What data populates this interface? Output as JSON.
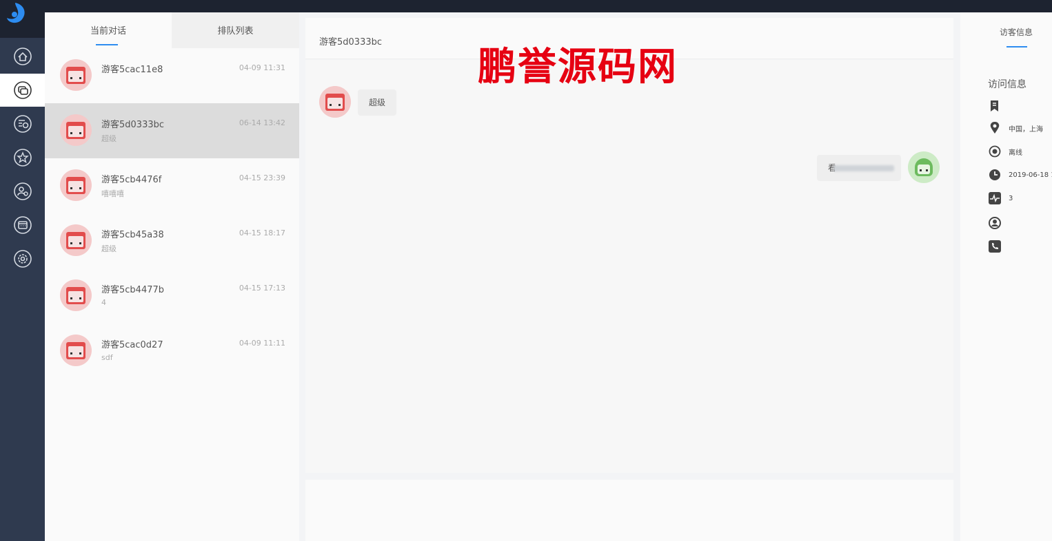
{
  "list": {
    "tabs": [
      "当前对话",
      "排队列表"
    ],
    "conversations": [
      {
        "name": "游客5cac11e8",
        "time": "04-09 11:31",
        "preview": ""
      },
      {
        "name": "游客5d0333bc",
        "time": "06-14 13:42",
        "preview": "超级"
      },
      {
        "name": "游客5cb4476f",
        "time": "04-15 23:39",
        "preview": "嘻嘻嘻"
      },
      {
        "name": "游客5cb45a38",
        "time": "04-15 18:17",
        "preview": "超级"
      },
      {
        "name": "游客5cb4477b",
        "time": "04-15 17:13",
        "preview": "4"
      },
      {
        "name": "游客5cac0d27",
        "time": "04-09 11:11",
        "preview": "sdf"
      }
    ]
  },
  "chat": {
    "title": "游客5d0333bc",
    "messages": [
      {
        "from": "visitor",
        "text": "超级"
      },
      {
        "from": "agent",
        "text": "看"
      }
    ]
  },
  "watermark": "鹏誉源码网",
  "info": {
    "tab": "访客信息",
    "heading": "访问信息",
    "rows": [
      {
        "icon": "bookmark-icon",
        "text": ""
      },
      {
        "icon": "location-icon",
        "text": "中国，上海"
      },
      {
        "icon": "radio-icon",
        "text": "离线"
      },
      {
        "icon": "clock-icon",
        "text": "2019-06-18 1"
      },
      {
        "icon": "pulse-icon",
        "text": "3"
      },
      {
        "icon": "user-icon",
        "text": ""
      },
      {
        "icon": "phone-icon",
        "text": ""
      }
    ]
  },
  "colors": {
    "accent": "#2d8cf0",
    "rail": "#2f3a4f",
    "topbar": "#1d2330",
    "watermark": "#e60012"
  }
}
